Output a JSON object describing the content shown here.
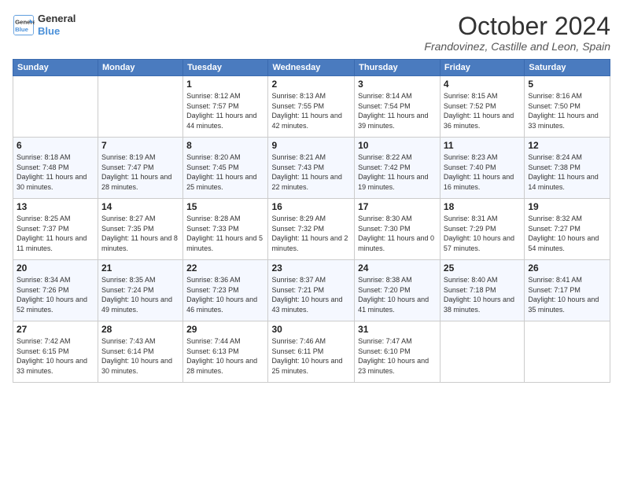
{
  "logo": {
    "line1": "General",
    "line2": "Blue"
  },
  "title": "October 2024",
  "subtitle": "Frandovinez, Castille and Leon, Spain",
  "days_header": [
    "Sunday",
    "Monday",
    "Tuesday",
    "Wednesday",
    "Thursday",
    "Friday",
    "Saturday"
  ],
  "weeks": [
    [
      {
        "day": "",
        "info": ""
      },
      {
        "day": "",
        "info": ""
      },
      {
        "day": "1",
        "info": "Sunrise: 8:12 AM\nSunset: 7:57 PM\nDaylight: 11 hours and 44 minutes."
      },
      {
        "day": "2",
        "info": "Sunrise: 8:13 AM\nSunset: 7:55 PM\nDaylight: 11 hours and 42 minutes."
      },
      {
        "day": "3",
        "info": "Sunrise: 8:14 AM\nSunset: 7:54 PM\nDaylight: 11 hours and 39 minutes."
      },
      {
        "day": "4",
        "info": "Sunrise: 8:15 AM\nSunset: 7:52 PM\nDaylight: 11 hours and 36 minutes."
      },
      {
        "day": "5",
        "info": "Sunrise: 8:16 AM\nSunset: 7:50 PM\nDaylight: 11 hours and 33 minutes."
      }
    ],
    [
      {
        "day": "6",
        "info": "Sunrise: 8:18 AM\nSunset: 7:48 PM\nDaylight: 11 hours and 30 minutes."
      },
      {
        "day": "7",
        "info": "Sunrise: 8:19 AM\nSunset: 7:47 PM\nDaylight: 11 hours and 28 minutes."
      },
      {
        "day": "8",
        "info": "Sunrise: 8:20 AM\nSunset: 7:45 PM\nDaylight: 11 hours and 25 minutes."
      },
      {
        "day": "9",
        "info": "Sunrise: 8:21 AM\nSunset: 7:43 PM\nDaylight: 11 hours and 22 minutes."
      },
      {
        "day": "10",
        "info": "Sunrise: 8:22 AM\nSunset: 7:42 PM\nDaylight: 11 hours and 19 minutes."
      },
      {
        "day": "11",
        "info": "Sunrise: 8:23 AM\nSunset: 7:40 PM\nDaylight: 11 hours and 16 minutes."
      },
      {
        "day": "12",
        "info": "Sunrise: 8:24 AM\nSunset: 7:38 PM\nDaylight: 11 hours and 14 minutes."
      }
    ],
    [
      {
        "day": "13",
        "info": "Sunrise: 8:25 AM\nSunset: 7:37 PM\nDaylight: 11 hours and 11 minutes."
      },
      {
        "day": "14",
        "info": "Sunrise: 8:27 AM\nSunset: 7:35 PM\nDaylight: 11 hours and 8 minutes."
      },
      {
        "day": "15",
        "info": "Sunrise: 8:28 AM\nSunset: 7:33 PM\nDaylight: 11 hours and 5 minutes."
      },
      {
        "day": "16",
        "info": "Sunrise: 8:29 AM\nSunset: 7:32 PM\nDaylight: 11 hours and 2 minutes."
      },
      {
        "day": "17",
        "info": "Sunrise: 8:30 AM\nSunset: 7:30 PM\nDaylight: 11 hours and 0 minutes."
      },
      {
        "day": "18",
        "info": "Sunrise: 8:31 AM\nSunset: 7:29 PM\nDaylight: 10 hours and 57 minutes."
      },
      {
        "day": "19",
        "info": "Sunrise: 8:32 AM\nSunset: 7:27 PM\nDaylight: 10 hours and 54 minutes."
      }
    ],
    [
      {
        "day": "20",
        "info": "Sunrise: 8:34 AM\nSunset: 7:26 PM\nDaylight: 10 hours and 52 minutes."
      },
      {
        "day": "21",
        "info": "Sunrise: 8:35 AM\nSunset: 7:24 PM\nDaylight: 10 hours and 49 minutes."
      },
      {
        "day": "22",
        "info": "Sunrise: 8:36 AM\nSunset: 7:23 PM\nDaylight: 10 hours and 46 minutes."
      },
      {
        "day": "23",
        "info": "Sunrise: 8:37 AM\nSunset: 7:21 PM\nDaylight: 10 hours and 43 minutes."
      },
      {
        "day": "24",
        "info": "Sunrise: 8:38 AM\nSunset: 7:20 PM\nDaylight: 10 hours and 41 minutes."
      },
      {
        "day": "25",
        "info": "Sunrise: 8:40 AM\nSunset: 7:18 PM\nDaylight: 10 hours and 38 minutes."
      },
      {
        "day": "26",
        "info": "Sunrise: 8:41 AM\nSunset: 7:17 PM\nDaylight: 10 hours and 35 minutes."
      }
    ],
    [
      {
        "day": "27",
        "info": "Sunrise: 7:42 AM\nSunset: 6:15 PM\nDaylight: 10 hours and 33 minutes."
      },
      {
        "day": "28",
        "info": "Sunrise: 7:43 AM\nSunset: 6:14 PM\nDaylight: 10 hours and 30 minutes."
      },
      {
        "day": "29",
        "info": "Sunrise: 7:44 AM\nSunset: 6:13 PM\nDaylight: 10 hours and 28 minutes."
      },
      {
        "day": "30",
        "info": "Sunrise: 7:46 AM\nSunset: 6:11 PM\nDaylight: 10 hours and 25 minutes."
      },
      {
        "day": "31",
        "info": "Sunrise: 7:47 AM\nSunset: 6:10 PM\nDaylight: 10 hours and 23 minutes."
      },
      {
        "day": "",
        "info": ""
      },
      {
        "day": "",
        "info": ""
      }
    ]
  ]
}
